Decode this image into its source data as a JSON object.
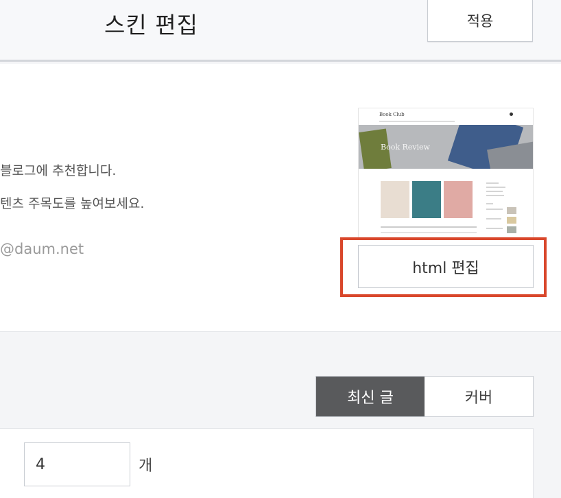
{
  "header": {
    "title": "스킨 편집",
    "apply_label": "적용"
  },
  "skin": {
    "desc_line1": "블로그에 추천합니다.",
    "desc_line2": "텐츠 주목도를 높여보세요.",
    "email": "@daum.net",
    "thumbnail": {
      "logo": "Book Club",
      "hero_text": "Book Review"
    },
    "html_edit_label": "html 편집"
  },
  "list_type": {
    "options": [
      "최신 글",
      "커버"
    ],
    "selected": "최신 글"
  },
  "post_count": {
    "value": "4",
    "unit": "개"
  },
  "colors": {
    "highlight": "#d9472b",
    "segment_active": "#595a5c"
  }
}
